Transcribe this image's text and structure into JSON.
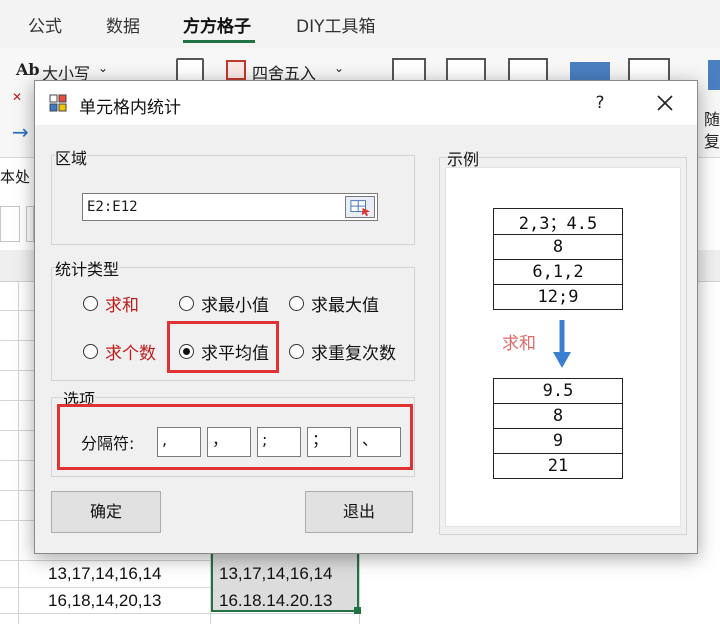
{
  "ribbon": {
    "tabs": [
      "公式",
      "数据",
      "方方格子",
      "DIY工具箱"
    ],
    "items": [
      "大小写",
      "四舍五入"
    ],
    "text_ab": "Ab",
    "side_labels": [
      "随",
      "复"
    ],
    "left_label": "本处"
  },
  "sheet": {
    "rows": [
      [
        "13,17,14,16,14",
        "13,17,14,16,14"
      ],
      [
        "16,18,14,20,13",
        "16.18.14.20.13"
      ]
    ]
  },
  "dialog": {
    "title": "单元格内统计",
    "help": "?",
    "region_label": "区域",
    "region_value": "E2:E12",
    "stat_type_label": "统计类型",
    "options": [
      "求和",
      "求最小值",
      "求最大值",
      "求个数",
      "求平均值",
      "求重复次数"
    ],
    "selected_option": "求平均值",
    "options_label": "选项",
    "separator_label": "分隔符:",
    "separators": [
      ",",
      "，",
      ";",
      "；",
      "、"
    ],
    "ok_label": "确定",
    "exit_label": "退出",
    "example": {
      "label": "示例",
      "input": [
        "2,3；4.5",
        "8",
        "6,1,2",
        "12;9"
      ],
      "op": "求和",
      "output": [
        "9.5",
        "8",
        "9",
        "21"
      ]
    }
  },
  "colors": {
    "highlight": "#e03232",
    "excel_green": "#217346",
    "arrow": "#3c7fd0",
    "red_text": "#c01c1c"
  }
}
